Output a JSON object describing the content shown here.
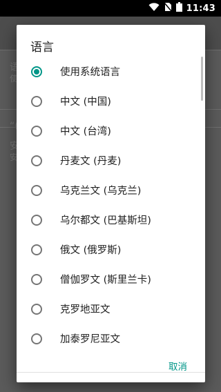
{
  "status_bar": {
    "time": "11:43",
    "icons": [
      "wifi-icon",
      "no-sim-icon",
      "battery-icon"
    ]
  },
  "background": {
    "rows": [
      {
        "title": "语",
        "sub": "使"
      },
      {
        "title": "“(",
        "sub": ""
      },
      {
        "title": "安",
        "sub": "安"
      }
    ]
  },
  "dialog": {
    "title": "语言",
    "selected_index": 0,
    "options": [
      "使用系统语言",
      "中文 (中国)",
      "中文 (台湾)",
      "丹麦文 (丹麦)",
      "乌克兰文 (乌克兰)",
      "乌尔都文 (巴基斯坦)",
      "俄文 (俄罗斯)",
      "僧伽罗文 (斯里兰卡)",
      "克罗地亚文",
      "加泰罗尼亚文"
    ],
    "cancel_label": "取消",
    "accent_color": "#009688"
  }
}
